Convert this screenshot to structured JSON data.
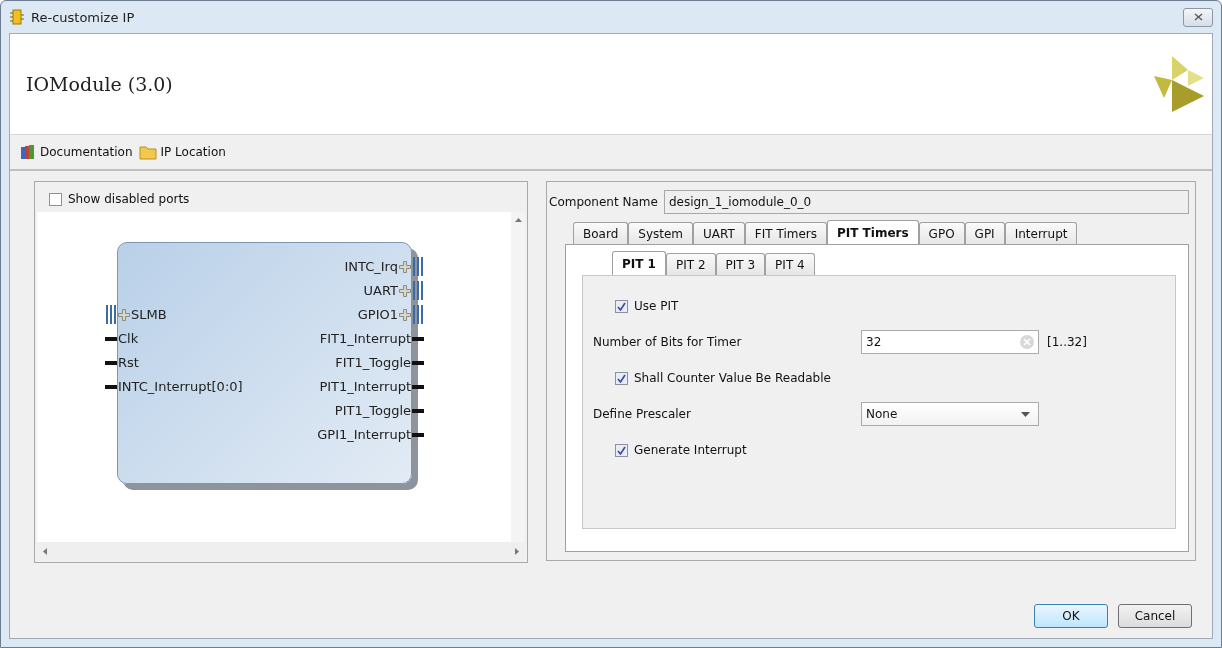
{
  "window": {
    "title": "Re-customize IP"
  },
  "header": {
    "title": "IOModule (3.0)"
  },
  "toolbar": [
    {
      "label": "Documentation",
      "kind": "books"
    },
    {
      "label": "IP Location",
      "kind": "folder"
    }
  ],
  "left_panel": {
    "show_disabled_ports": {
      "label": "Show disabled ports",
      "checked": false
    },
    "block": {
      "rows": [
        {
          "right": {
            "label": "INTC_Irq",
            "kind": "bus"
          }
        },
        {
          "right": {
            "label": "UART",
            "kind": "bus"
          }
        },
        {
          "left": {
            "label": "SLMB",
            "kind": "bus"
          },
          "right": {
            "label": "GPIO1",
            "kind": "bus"
          }
        },
        {
          "left": {
            "label": "Clk",
            "kind": "wire"
          },
          "right": {
            "label": "FIT1_Interrupt",
            "kind": "wire"
          }
        },
        {
          "left": {
            "label": "Rst",
            "kind": "wire"
          },
          "right": {
            "label": "FIT1_Toggle",
            "kind": "wire"
          }
        },
        {
          "left": {
            "label": "INTC_Interrupt[0:0]",
            "kind": "wire"
          },
          "right": {
            "label": "PIT1_Interrupt",
            "kind": "wire"
          }
        },
        {
          "right": {
            "label": "PIT1_Toggle",
            "kind": "wire"
          }
        },
        {
          "right": {
            "label": "GPI1_Interrupt",
            "kind": "wire"
          }
        }
      ]
    }
  },
  "right_panel": {
    "component_name": {
      "label": "Component Name",
      "value": "design_1_iomodule_0_0"
    },
    "tabs": [
      {
        "label": "Board",
        "selected": false
      },
      {
        "label": "System",
        "selected": false
      },
      {
        "label": "UART",
        "selected": false
      },
      {
        "label": "FIT Timers",
        "selected": false
      },
      {
        "label": "PIT Timers",
        "selected": true
      },
      {
        "label": "GPO",
        "selected": false
      },
      {
        "label": "GPI",
        "selected": false
      },
      {
        "label": "Interrupt",
        "selected": false
      }
    ],
    "subtabs": [
      {
        "label": "PIT 1",
        "selected": true
      },
      {
        "label": "PIT 2",
        "selected": false
      },
      {
        "label": "PIT 3",
        "selected": false
      },
      {
        "label": "PIT 4",
        "selected": false
      }
    ],
    "fields": [
      {
        "kind": "checkbox",
        "label": "Use PIT",
        "checked": true
      },
      {
        "kind": "text",
        "label": "Number of Bits for Timer",
        "value": "32",
        "range": "[1..32]"
      },
      {
        "kind": "checkbox",
        "label": "Shall Counter Value Be Readable",
        "checked": true
      },
      {
        "kind": "select",
        "label": "Define Prescaler",
        "value": "None"
      },
      {
        "kind": "checkbox",
        "label": "Generate Interrupt",
        "checked": true
      }
    ]
  },
  "buttons": [
    {
      "label": "OK",
      "kind": "default"
    },
    {
      "label": "Cancel",
      "kind": "normal"
    }
  ]
}
